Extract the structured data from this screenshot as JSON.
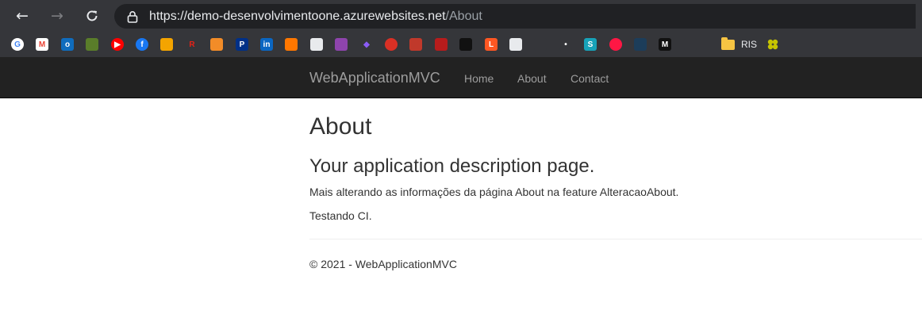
{
  "browser": {
    "url_main": "https://demo-desenvolvimentoone.azurewebsites.net",
    "url_path": "/About",
    "back_icon": "arrow-left-icon",
    "forward_icon": "arrow-right-icon",
    "reload_icon": "reload-icon",
    "lock_icon": "lock-icon",
    "bookmarks": [
      {
        "icon": "google-icon",
        "glyph": "G",
        "color": "#ffffff",
        "fg": "#4285f4"
      },
      {
        "icon": "gmail-icon",
        "glyph": "M",
        "color": "#ffffff",
        "fg": "#ea4335"
      },
      {
        "icon": "outlook-icon",
        "glyph": "o",
        "color": "#0f6cbd",
        "fg": "#ffffff"
      },
      {
        "icon": "green-box-icon",
        "glyph": "",
        "color": "#5a7d2a",
        "fg": "#ffffff"
      },
      {
        "icon": "youtube-icon",
        "glyph": "▶",
        "color": "#ff0000",
        "fg": "#ffffff"
      },
      {
        "icon": "facebook-icon",
        "glyph": "f",
        "color": "#1877f2",
        "fg": "#ffffff"
      },
      {
        "icon": "orange-logo-icon",
        "glyph": "",
        "color": "#f4a400",
        "fg": "#ffffff"
      },
      {
        "icon": "red-r-icon",
        "glyph": "R",
        "color": "#35363a",
        "fg": "#e62117"
      },
      {
        "icon": "orange-box-icon",
        "glyph": "",
        "color": "#f28c28",
        "fg": "#ffffff"
      },
      {
        "icon": "paypal-icon",
        "glyph": "P",
        "color": "#003087",
        "fg": "#ffffff"
      },
      {
        "icon": "linkedin-icon",
        "glyph": "in",
        "color": "#0a66c2",
        "fg": "#ffffff"
      },
      {
        "icon": "soundcloud-icon",
        "glyph": "",
        "color": "#ff7700",
        "fg": "#ffffff"
      },
      {
        "icon": "white-logo-icon",
        "glyph": "",
        "color": "#e8eaed",
        "fg": "#35363a"
      },
      {
        "icon": "purple-logo-icon",
        "glyph": "",
        "color": "#8e44ad",
        "fg": "#ffffff"
      },
      {
        "icon": "violet-diamond-icon",
        "glyph": "◆",
        "color": "#35363a",
        "fg": "#8b5cf6"
      },
      {
        "icon": "red-circle-icon",
        "glyph": "",
        "color": "#d93025",
        "fg": "#ffffff"
      },
      {
        "icon": "red-white-logo-icon",
        "glyph": "",
        "color": "#c0392b",
        "fg": "#ffffff"
      },
      {
        "icon": "red-stripes-icon",
        "glyph": "",
        "color": "#b71c1c",
        "fg": "#ffffff"
      },
      {
        "icon": "black-logo-icon",
        "glyph": "",
        "color": "#111111",
        "fg": "#ffffff"
      },
      {
        "icon": "orange-l-icon",
        "glyph": "L",
        "color": "#ff5722",
        "fg": "#ffffff"
      },
      {
        "icon": "white-ball-icon",
        "glyph": "",
        "color": "#e8eaed",
        "fg": "#d93025"
      },
      {
        "icon": "green-leaf-icon",
        "glyph": "",
        "color": "#35363a",
        "fg": "#4caf50"
      },
      {
        "icon": "white-dot-icon",
        "glyph": "•",
        "color": "#35363a",
        "fg": "#ffffff"
      },
      {
        "icon": "cyan-s-icon",
        "glyph": "S",
        "color": "#17a2b8",
        "fg": "#ffffff"
      },
      {
        "icon": "pink-circle-icon",
        "glyph": "",
        "color": "#ff1744",
        "fg": "#ffffff"
      },
      {
        "icon": "dark-blue-icon",
        "glyph": "",
        "color": "#1c3d5a",
        "fg": "#ffffff"
      },
      {
        "icon": "m-logo-icon",
        "glyph": "M",
        "color": "#111111",
        "fg": "#ffffff"
      },
      {
        "icon": "huawei-icon",
        "glyph": "",
        "color": "#35363a",
        "fg": "#cf0a2c"
      },
      {
        "icon": "yellow-flower-icon",
        "glyph": "",
        "color": "#35363a",
        "fg": "#c6c400"
      }
    ],
    "folder_label": "RIS",
    "folder_icon": "folder-icon"
  },
  "navbar": {
    "brand": "WebApplicationMVC",
    "links": [
      "Home",
      "About",
      "Contact"
    ]
  },
  "main": {
    "title": "About",
    "subtitle": "Your application description page.",
    "paragraphs": [
      "Mais alterando as informações da página About na feature AlteracaoAbout.",
      "Testando CI."
    ]
  },
  "footer": {
    "text": "© 2021 - WebApplicationMVC"
  }
}
